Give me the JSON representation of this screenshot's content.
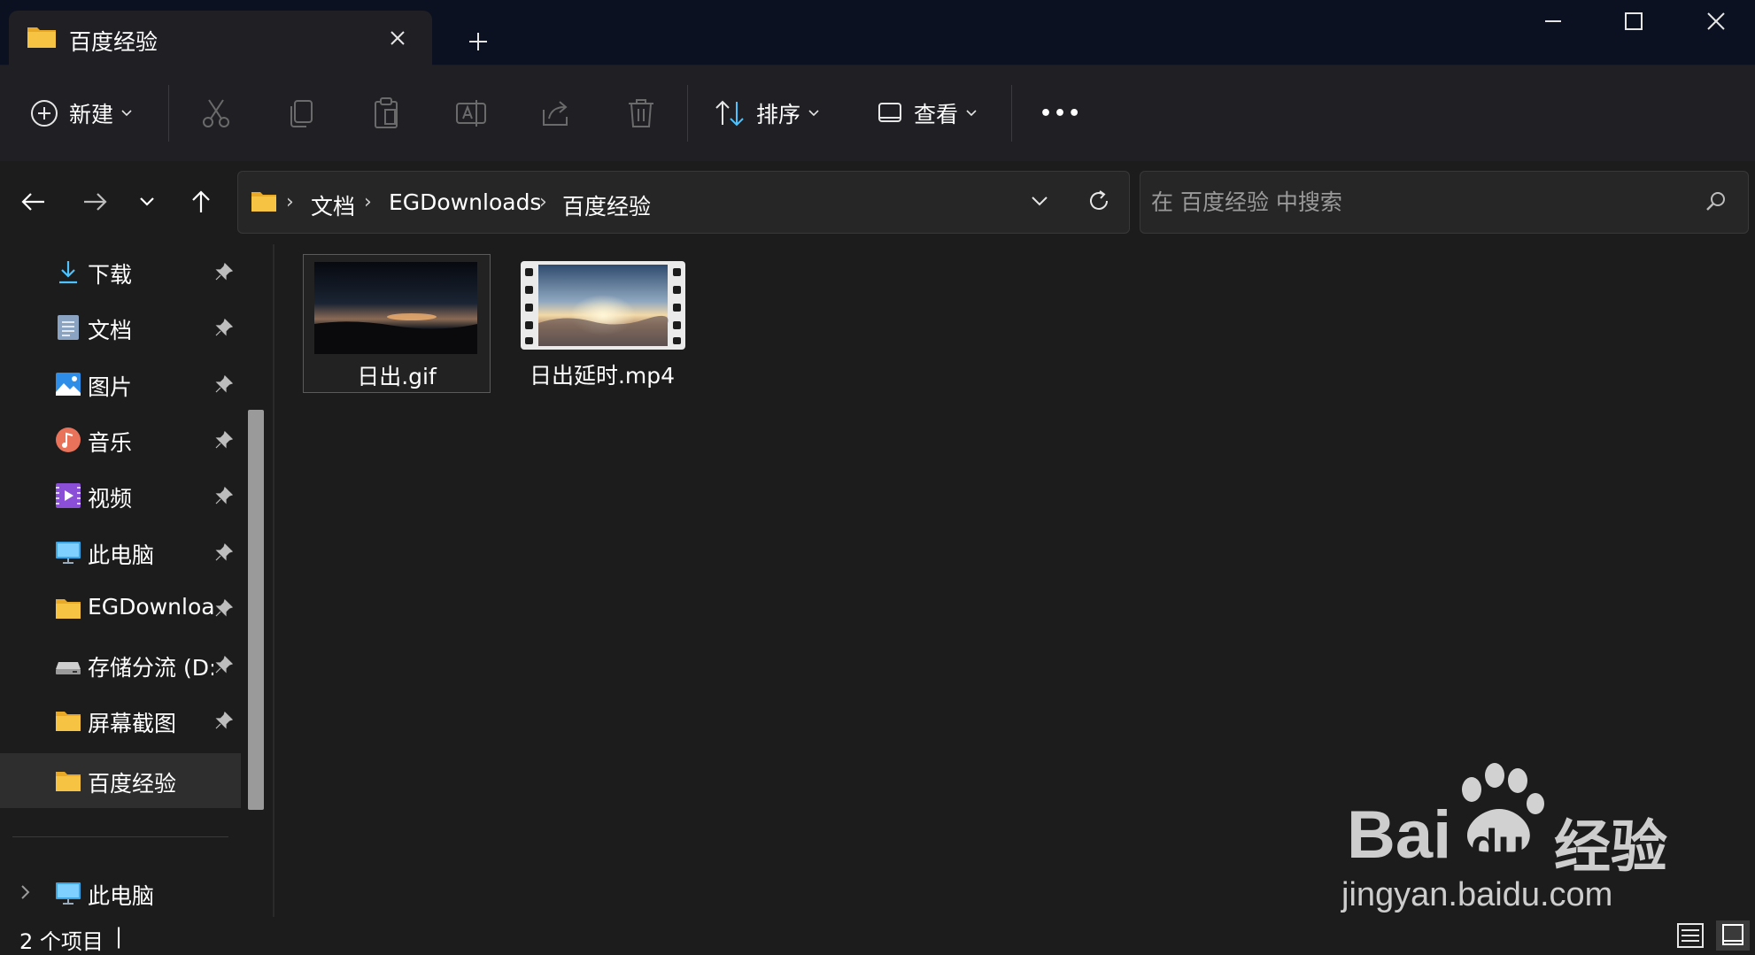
{
  "window": {
    "tab_title": "百度经验",
    "tab_close": "close-tab",
    "new_tab": "+"
  },
  "toolbar": {
    "new_label": "新建",
    "sort_label": "排序",
    "view_label": "查看",
    "more_label": "•••"
  },
  "address": {
    "crumbs": [
      "文档",
      "EGDownloads",
      "百度经验"
    ],
    "separator": "›"
  },
  "search": {
    "placeholder": "在 百度经验 中搜索"
  },
  "sidebar": {
    "items": [
      {
        "label": "下载",
        "icon": "download-icon",
        "pinned": true
      },
      {
        "label": "文档",
        "icon": "documents-icon",
        "pinned": true
      },
      {
        "label": "图片",
        "icon": "pictures-icon",
        "pinned": true
      },
      {
        "label": "音乐",
        "icon": "music-icon",
        "pinned": true
      },
      {
        "label": "视频",
        "icon": "videos-icon",
        "pinned": true
      },
      {
        "label": "此电脑",
        "icon": "this-pc-icon",
        "pinned": true
      },
      {
        "label": "EGDownloac",
        "icon": "folder-icon",
        "pinned": true
      },
      {
        "label": "存储分流 (D:)",
        "icon": "drive-icon",
        "pinned": true
      },
      {
        "label": "屏幕截图",
        "icon": "folder-icon",
        "pinned": true
      },
      {
        "label": "百度经验",
        "icon": "folder-icon",
        "pinned": false,
        "selected": true
      }
    ],
    "tree_item": {
      "label": "此电脑",
      "icon": "this-pc-icon"
    }
  },
  "files": [
    {
      "name": "日出.gif",
      "type": "gif-image"
    },
    {
      "name": "日出延时.mp4",
      "type": "video"
    }
  ],
  "status": {
    "count_text": "2 个项目",
    "cursor": "|"
  },
  "watermark": {
    "logo_text": "Bai",
    "logo_text2": "du",
    "suffix": "经验",
    "url": "jingyan.baidu.com"
  },
  "colors": {
    "titlebar": "#0b1120",
    "toolbar": "#1f1f24",
    "background": "#1c1c1c",
    "folder": "#f6c342",
    "accent": "#4cc2ff"
  }
}
